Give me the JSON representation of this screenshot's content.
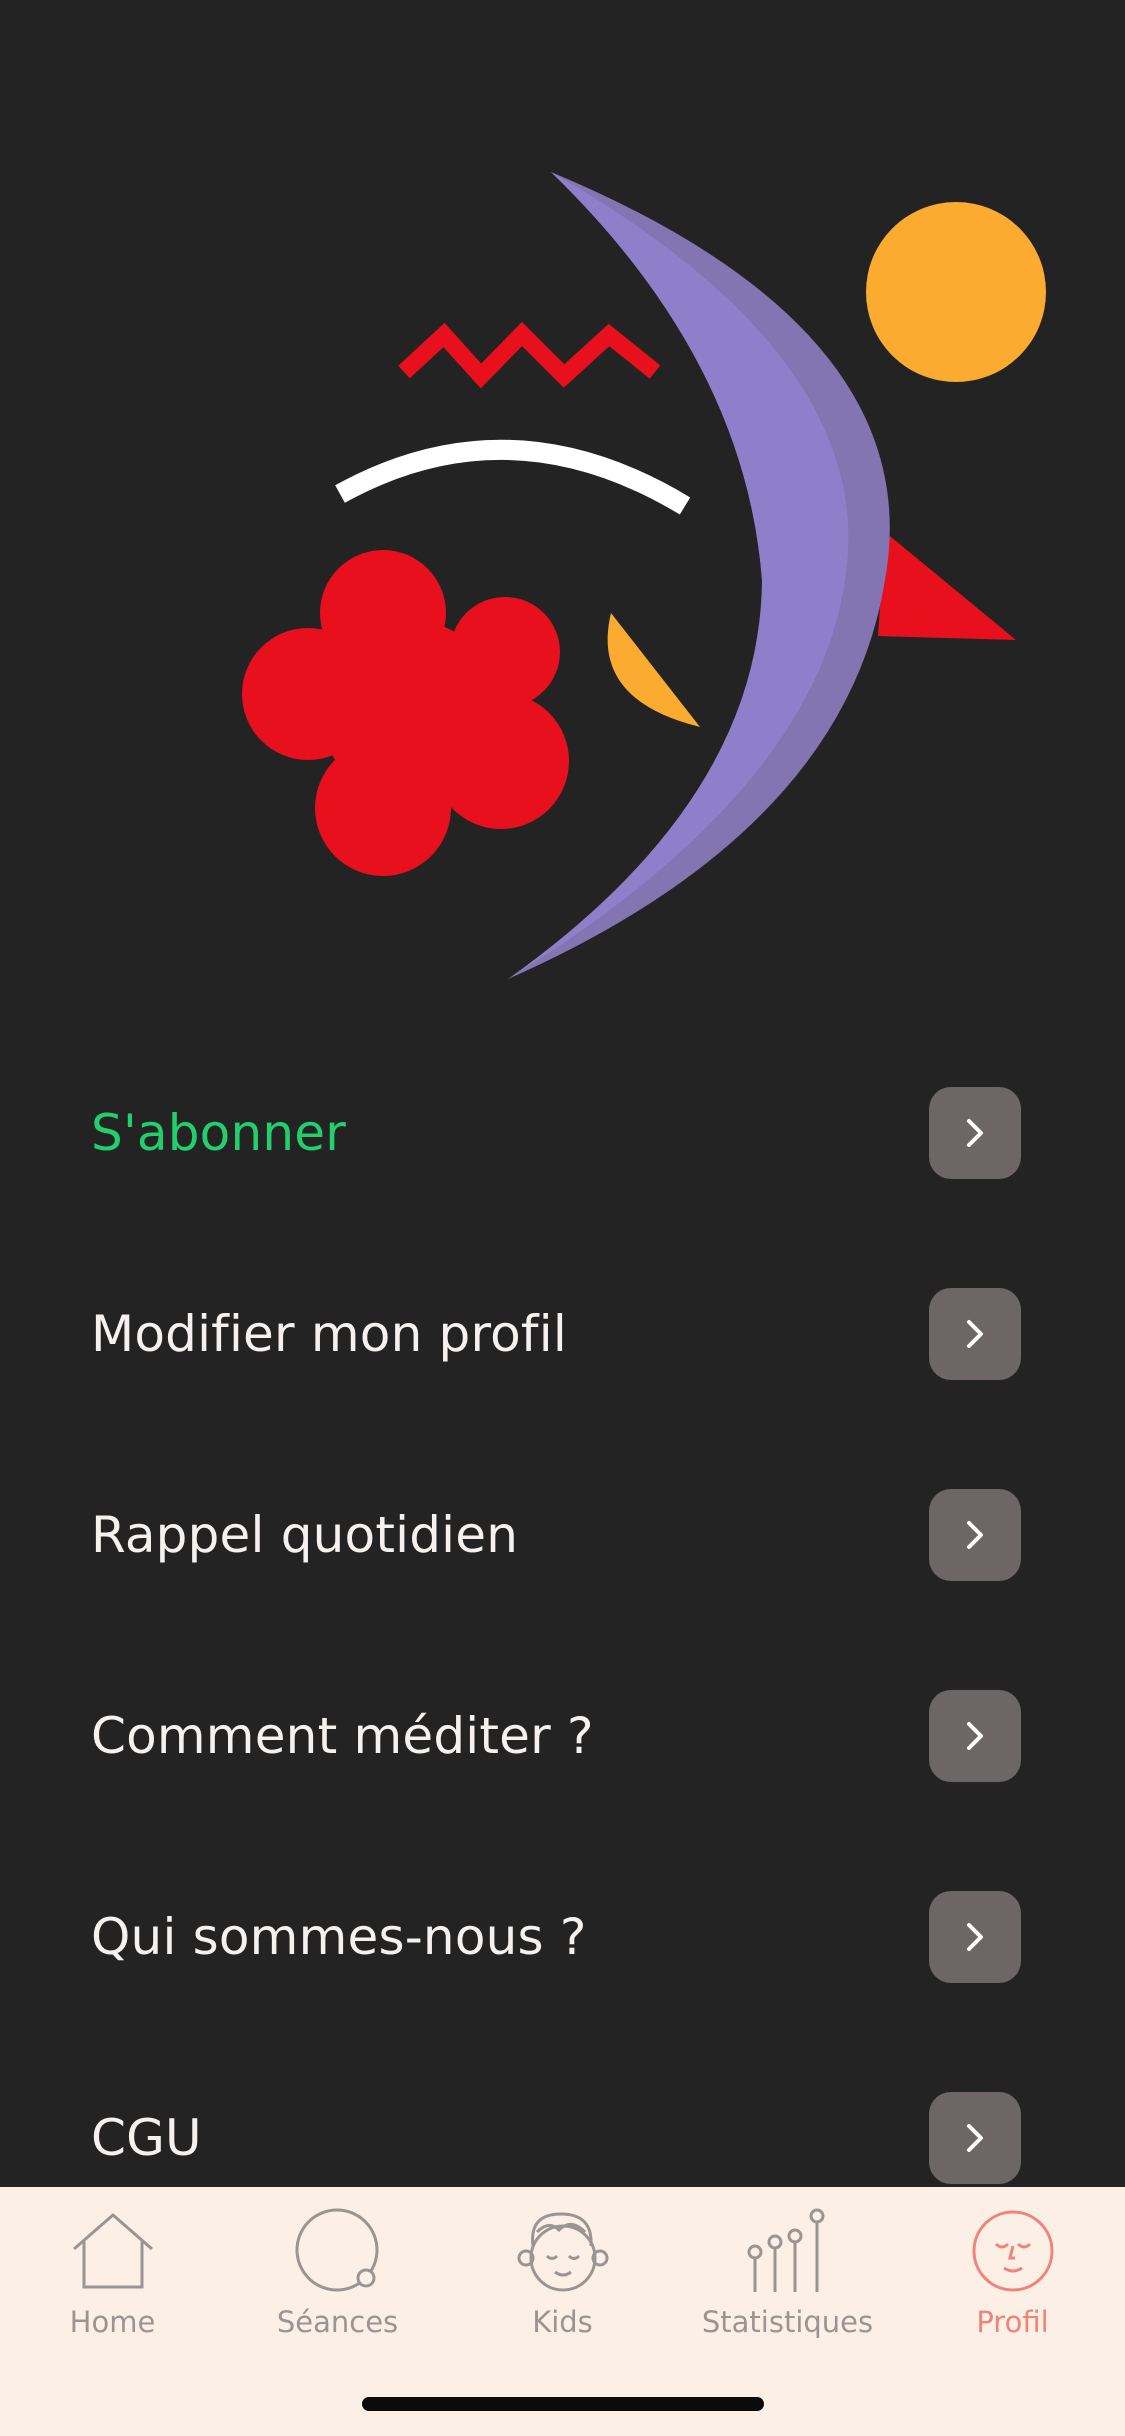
{
  "menu": {
    "items": [
      {
        "label": "S'abonner",
        "accent": true
      },
      {
        "label": "Modifier mon profil",
        "accent": false
      },
      {
        "label": "Rappel quotidien",
        "accent": false
      },
      {
        "label": "Comment méditer ?",
        "accent": false
      },
      {
        "label": "Qui sommes-nous ?",
        "accent": false
      },
      {
        "label": "CGU",
        "accent": false
      }
    ],
    "chevron_icon": "chevron-right-icon"
  },
  "tabbar": {
    "tabs": [
      {
        "label": "Home",
        "icon": "house-icon",
        "active": false
      },
      {
        "label": "Séances",
        "icon": "circle-icon",
        "active": false
      },
      {
        "label": "Kids",
        "icon": "child-face-icon",
        "active": false
      },
      {
        "label": "Statistiques",
        "icon": "stats-icon",
        "active": false
      },
      {
        "label": "Profil",
        "icon": "smiling-face-icon",
        "active": true
      }
    ]
  },
  "colors": {
    "background": "#242324",
    "accent_green": "#22cf6e",
    "tab_active": "#f08478",
    "tab_inactive": "#9a9593",
    "tabbar_background": "#fcf0e6",
    "chevron_button": "#6c6666"
  }
}
